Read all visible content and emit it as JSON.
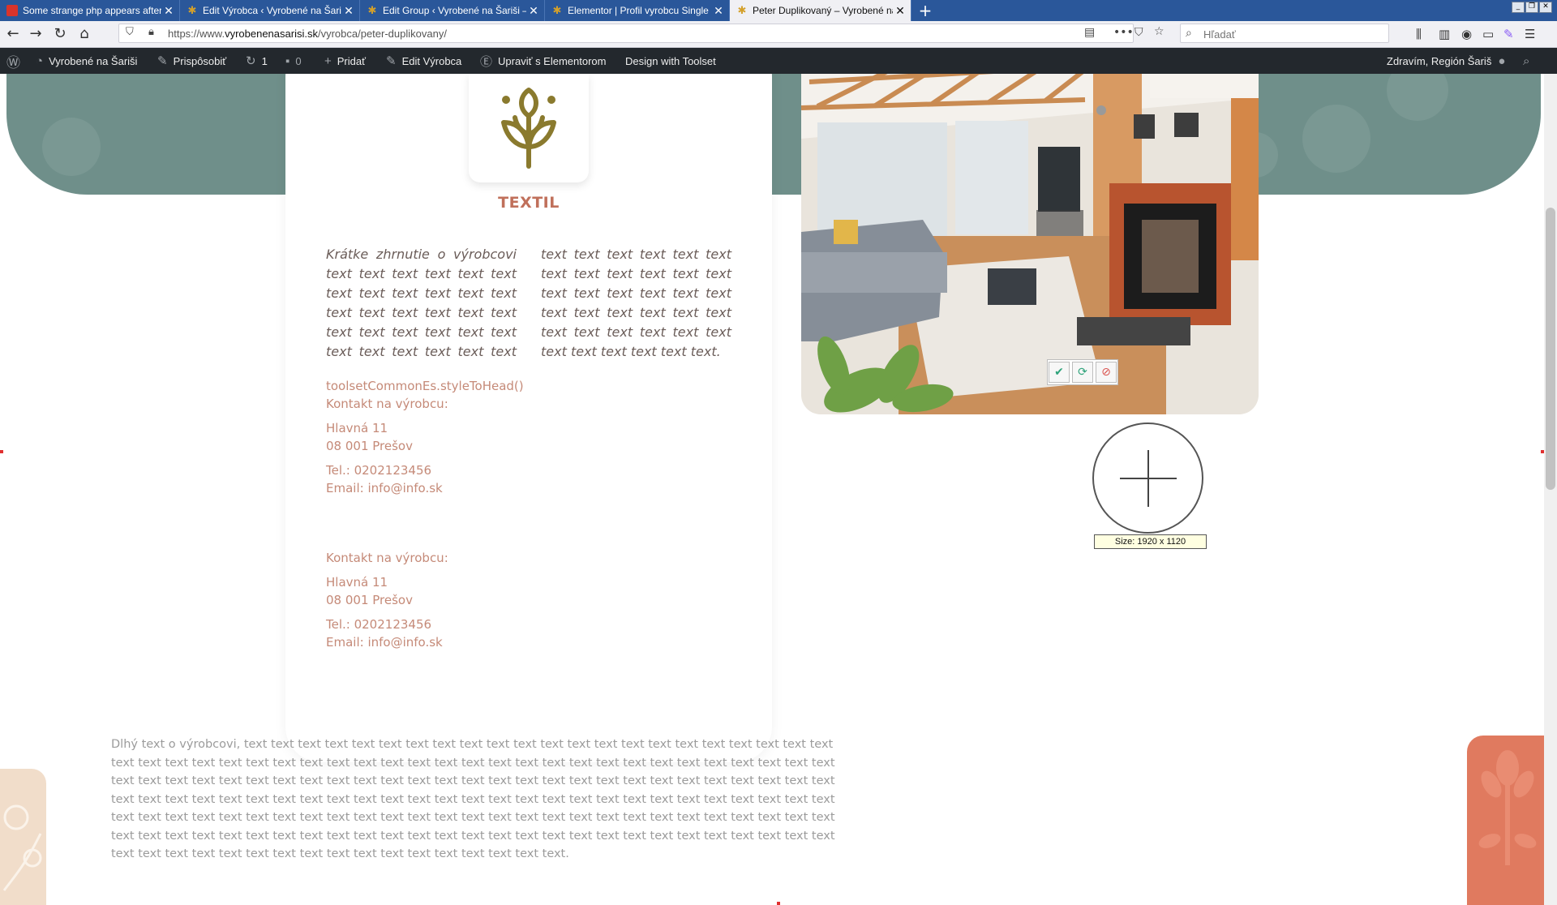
{
  "browser": {
    "tabs": [
      {
        "title": "Some strange php appears after p",
        "active": false
      },
      {
        "title": "Edit Výrobca ‹ Vyrobené na Šariši",
        "active": false
      },
      {
        "title": "Edit Group ‹ Vyrobené na Šariši —",
        "active": false
      },
      {
        "title": "Elementor | Profil vyrobcu Single p",
        "active": false
      },
      {
        "title": "Peter Duplikovaný – Vyrobené na",
        "active": true
      }
    ],
    "url_prefix": "https://www.",
    "url_domain": "vyrobenenasarisi.sk",
    "url_path": "/vyrobca/peter-duplikovany/",
    "search_placeholder": "Hľadať"
  },
  "admin_bar": {
    "site_name": "Vyrobené na Šariši",
    "customize": "Prispôsobiť",
    "updates_count": "1",
    "comments_count": "0",
    "new_label": "Pridať",
    "edit_label": "Edit Výrobca",
    "elementor_label": "Upraviť s Elementorom",
    "toolset_label": "Design with Toolset",
    "greeting": "Zdravím, Región Šariš"
  },
  "card": {
    "category": "TEXTIL",
    "summary": "Krátke zhrnutie o výrobcovi text text text text text text text text text text text text text text text text text text text text text text text text text text text text text text text text text text text text text text text text text text text text text text text text text text text text text text text text text text text text text text text text text text.",
    "contact1": {
      "script_text": "toolsetCommonEs.styleToHead()",
      "heading": "Kontakt na výrobcu:",
      "street": "Hlavná 11",
      "city": "08 001 Prešov",
      "phone": "Tel.: 0202123456",
      "email": "Email: info@info.sk"
    },
    "contact2": {
      "heading": "Kontakt na výrobcu:",
      "street": "Hlavná 11",
      "city": "08 001 Prešov",
      "phone": "Tel.: 0202123456",
      "email": "Email: info@info.sk"
    }
  },
  "overlay": {
    "size_label": "Size: 1920 x 1120"
  },
  "long_text": "Dlhý text o výrobcovi, text text text text text text text text text text text text text text text text text text text text text text text text text text text text text text text text text text text text text text text text text text text text text text text text text text text text text text text text text text text text text text text text text text text text text text text text text text text text text text text text text text text text text text text text text text text text text text text text text text text text text text text text text text text text text text text text text text text text text text text text text text text text text text text text text text text text text text text text text text text text text text text text text text text text text text text text text text text text text text text text text text text text text text text text text text text text text text.",
  "colors": {
    "teal_band": "#6f8f8a",
    "accent": "#c0705b",
    "contact_text": "#c58a78",
    "icon_olive": "#8a7a2e",
    "deco_orange": "#e07a5f",
    "deco_beige": "#f1ddca"
  },
  "icons": {
    "category_icon": "plant-sprout-icon",
    "resize_apply": "check-icon",
    "resize_refresh": "refresh-icon",
    "resize_cancel": "cancel-icon"
  }
}
